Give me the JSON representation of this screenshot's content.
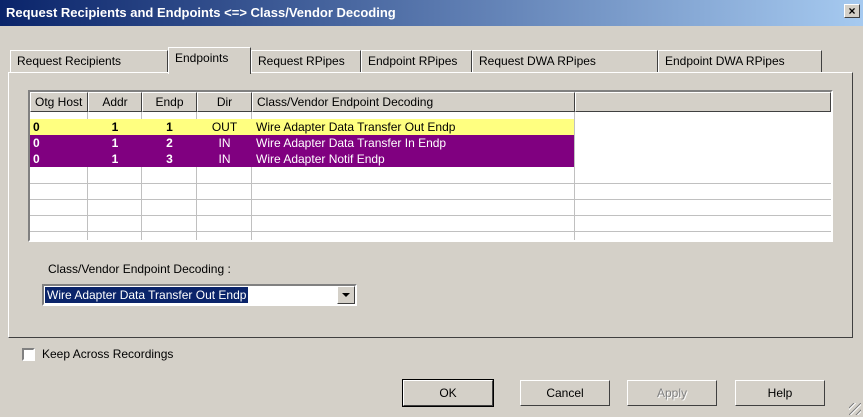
{
  "window": {
    "title": "Request Recipients and Endpoints <=> Class/Vendor Decoding",
    "close_label": "×"
  },
  "tabs": [
    {
      "label": "Request Recipients"
    },
    {
      "label": "Endpoints"
    },
    {
      "label": "Request RPipes"
    },
    {
      "label": "Endpoint RPipes"
    },
    {
      "label": "Request DWA RPipes"
    },
    {
      "label": "Endpoint DWA RPipes"
    }
  ],
  "active_tab": "Endpoints",
  "table": {
    "headers": [
      "Otg Host",
      "Addr",
      "Endp",
      "Dir",
      "Class/Vendor Endpoint Decoding"
    ],
    "rows": [
      {
        "otg": "0",
        "addr": "1",
        "endp": "1",
        "dir": "OUT",
        "decoding": "Wire Adapter Data Transfer Out Endp"
      },
      {
        "otg": "0",
        "addr": "1",
        "endp": "2",
        "dir": "IN",
        "decoding": "Wire Adapter Data Transfer In Endp"
      },
      {
        "otg": "0",
        "addr": "1",
        "endp": "3",
        "dir": "IN",
        "decoding": "Wire Adapter Notif Endp"
      }
    ]
  },
  "colors": {
    "row_out_bg": "#ffff80",
    "row_in_bg": "#800080",
    "row_in_fg": "#ffffff",
    "title_bg": "#0a246a"
  },
  "decoding": {
    "label": "Class/Vendor Endpoint Decoding :",
    "selected": "Wire Adapter Data Transfer Out Endp"
  },
  "keep_across": {
    "label": "Keep Across Recordings",
    "checked": false
  },
  "buttons": {
    "ok": "OK",
    "cancel": "Cancel",
    "apply": "Apply",
    "help": "Help"
  }
}
